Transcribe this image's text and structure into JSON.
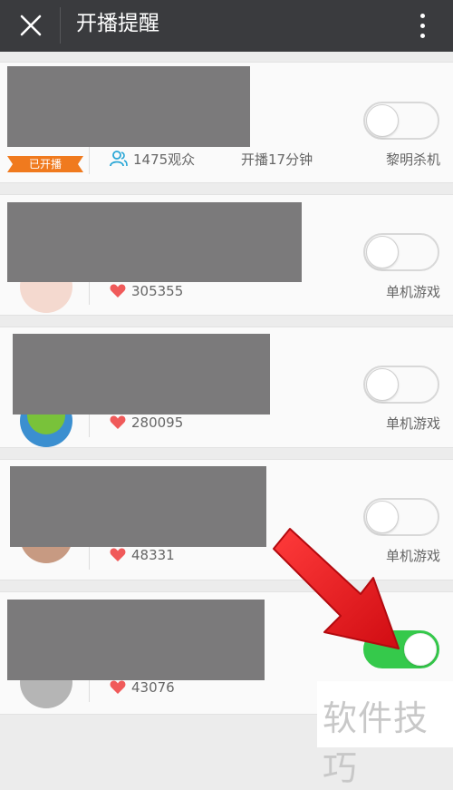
{
  "header": {
    "title": "开播提醒",
    "close_icon": "close-icon",
    "more_icon": "more-vertical-icon"
  },
  "rows": [
    {
      "badge": "已开播",
      "stat_icon": "viewers-icon",
      "stat": "1475观众",
      "extra": "开播17分钟",
      "category": "黎明杀机",
      "subscribed": false
    },
    {
      "stat_icon": "heart-icon",
      "stat": "305355",
      "category": "单机游戏",
      "subscribed": false
    },
    {
      "stat_icon": "heart-icon",
      "stat": "280095",
      "category": "单机游戏",
      "subscribed": false
    },
    {
      "stat_icon": "heart-icon",
      "stat": "48331",
      "category": "单机游戏",
      "subscribed": false
    },
    {
      "stat_icon": "heart-icon",
      "stat": "43076",
      "subscribed": true
    }
  ],
  "watermark": "软件技巧",
  "colors": {
    "topbar": "#3a3b3e",
    "toggle_on": "#35c94b",
    "heart": "#f05a5a",
    "viewers": "#2aa7d6",
    "badge": "#f07a1e",
    "arrow": "#e8151b"
  }
}
